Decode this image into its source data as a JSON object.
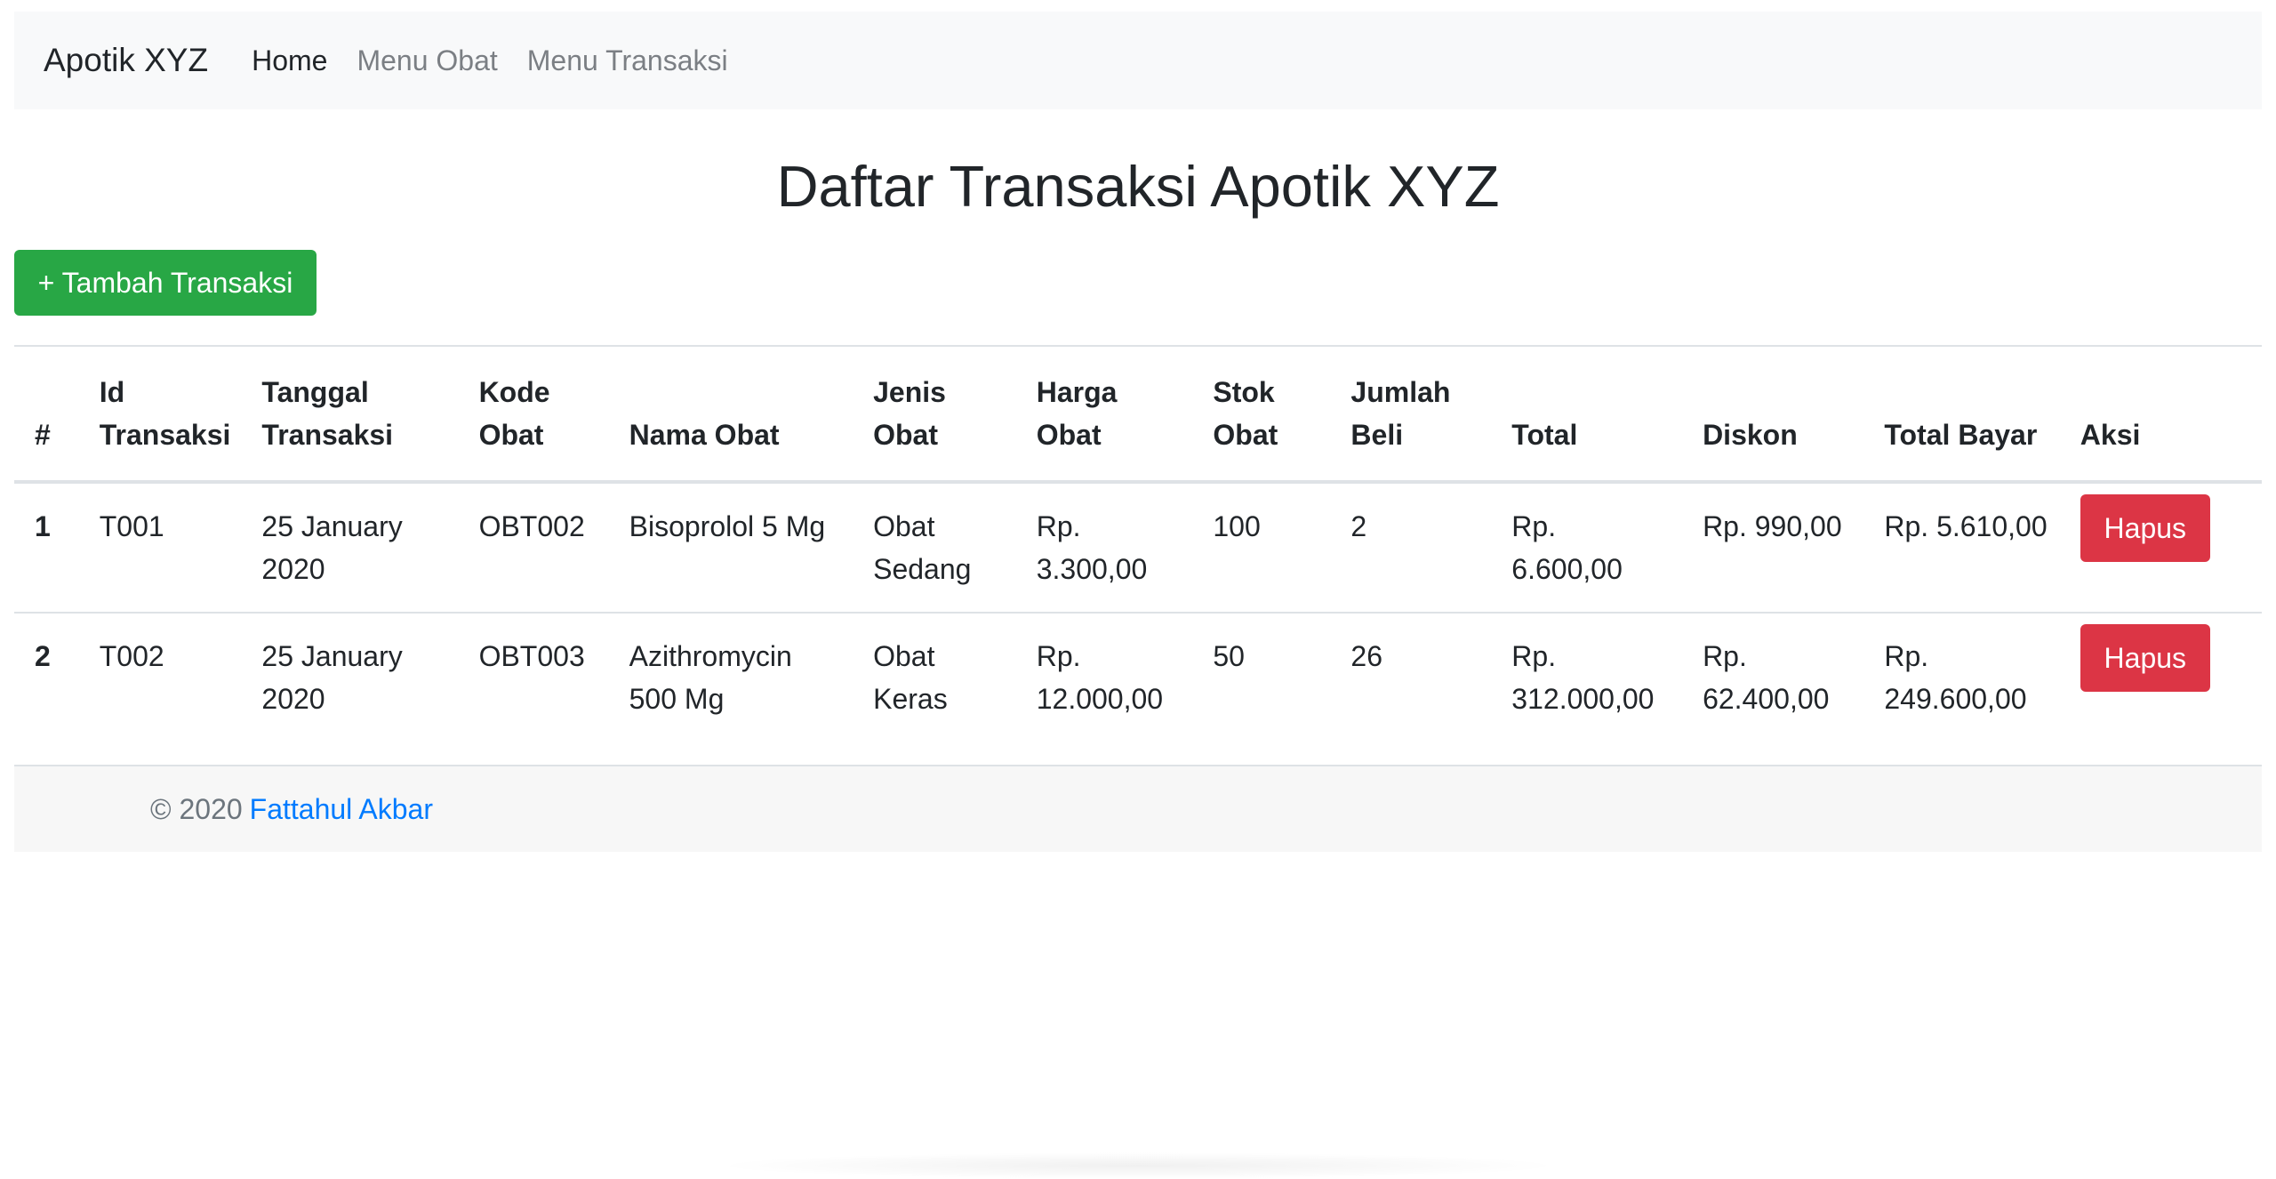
{
  "navbar": {
    "brand": "Apotik XYZ",
    "links": [
      {
        "label": "Home"
      },
      {
        "label": "Menu Obat"
      },
      {
        "label": "Menu Transaksi"
      }
    ]
  },
  "page": {
    "title": "Daftar Transaksi Apotik XYZ",
    "add_button": "+ Tambah Transaksi"
  },
  "table": {
    "headers": [
      "#",
      "Id Transaksi",
      "Tanggal Transaksi",
      "Kode Obat",
      "Nama Obat",
      "Jenis Obat",
      "Harga Obat",
      "Stok Obat",
      "Jumlah Beli",
      "Total",
      "Diskon",
      "Total Bayar",
      "Aksi"
    ],
    "rows": [
      {
        "no": "1",
        "id": "T001",
        "tanggal": "25 January 2020",
        "kode": "OBT002",
        "nama": "Bisoprolol 5 Mg",
        "jenis": "Obat Sedang",
        "harga": "Rp. 3.300,00",
        "stok": "100",
        "jumlah": "2",
        "total": "Rp. 6.600,00",
        "diskon": "Rp. 990,00",
        "total_bayar": "Rp. 5.610,00",
        "aksi": "Hapus"
      },
      {
        "no": "2",
        "id": "T002",
        "tanggal": "25 January 2020",
        "kode": "OBT003",
        "nama": "Azithromycin 500 Mg",
        "jenis": "Obat Keras",
        "harga": "Rp. 12.000,00",
        "stok": "50",
        "jumlah": "26",
        "total": "Rp. 312.000,00",
        "diskon": "Rp. 62.400,00",
        "total_bayar": "Rp. 249.600,00",
        "aksi": "Hapus"
      }
    ]
  },
  "footer": {
    "copyright": "© 2020",
    "author": "Fattahul Akbar"
  },
  "colors": {
    "success": "#28a745",
    "danger": "#dc3545",
    "link": "#007bff",
    "navbar_bg": "#f8f9fa"
  }
}
